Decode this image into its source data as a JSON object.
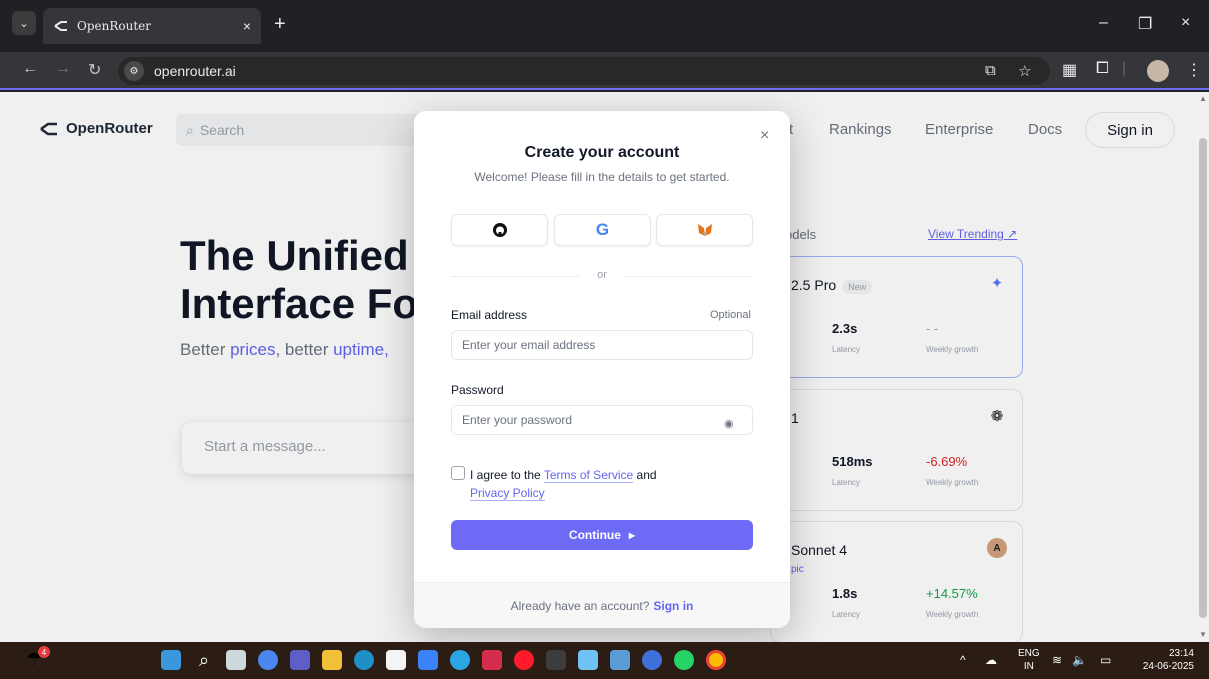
{
  "browser": {
    "tab_title": "OpenRouter",
    "tab_close": "×",
    "new_tab": "+",
    "url": "openrouter.ai",
    "min": "–",
    "restore": "❐",
    "close": "×"
  },
  "site": {
    "logo_text": "OpenRouter",
    "search_placeholder": "Search",
    "nav": [
      "t",
      "Rankings",
      "Enterprise",
      "Docs"
    ],
    "signin": "Sign in",
    "hero_line1": "The Unified",
    "hero_line2": "Interface For",
    "hero_sub_1": "Better ",
    "hero_sub_2": "prices",
    "hero_sub_3": ", better ",
    "hero_sub_4": "uptime,",
    "message_placeholder": "Start a message...",
    "models_head": "odels",
    "view_trending": "View Trending",
    "cards": [
      {
        "name": "2.5 Pro",
        "badge": "New",
        "sub": "",
        "latency": "2.3s",
        "latency_label": "Latency",
        "growth": "- -",
        "growth_label": "Weekly growth",
        "growth_color": "#9ca3af"
      },
      {
        "name": "1",
        "badge": "",
        "sub": "",
        "latency": "518ms",
        "latency_label": "Latency",
        "growth": "-6.69%",
        "growth_label": "Weekly growth",
        "growth_color": "#dc2626"
      },
      {
        "name": "Sonnet 4",
        "badge": "",
        "sub": "pic",
        "latency": "1.8s",
        "latency_label": "Latency",
        "growth": "+14.57%",
        "growth_label": "Weekly growth",
        "growth_color": "#16a34a"
      }
    ]
  },
  "modal": {
    "title": "Create your account",
    "welcome": "Welcome! Please fill in the details to get started.",
    "or": "or",
    "email_label": "Email address",
    "optional": "Optional",
    "email_placeholder": "Enter your email address",
    "password_label": "Password",
    "password_placeholder": "Enter your password",
    "agree_1": "I agree to the ",
    "terms": "Terms of Service",
    "agree_2": " and",
    "privacy": "Privacy Policy",
    "continue": "Continue",
    "footer_text": "Already have an account?",
    "footer_link": "Sign in",
    "close": "×"
  },
  "taskbar": {
    "weather_badge": "4",
    "lang_1": "ENG",
    "lang_2": "IN",
    "time": "23:14",
    "date": "24-06-2025"
  },
  "colors": {
    "accent": "#6d6af6",
    "link": "#6366f1",
    "taskbar": "#2b1d14"
  }
}
